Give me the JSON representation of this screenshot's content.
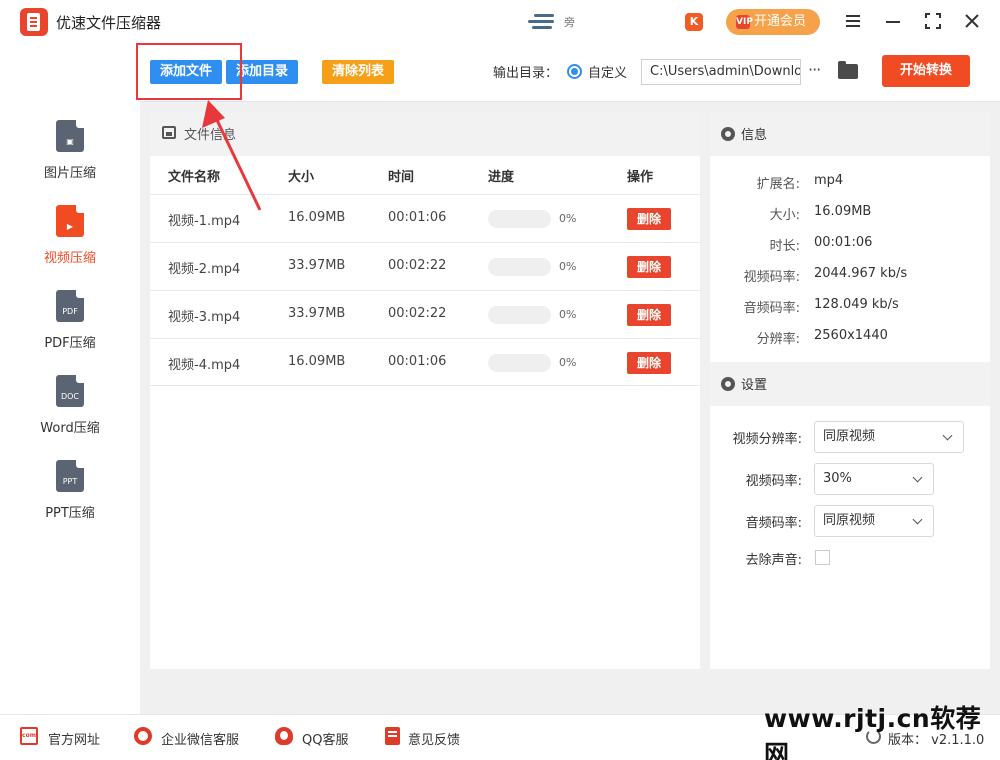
{
  "app": {
    "title": "优速文件压缩器",
    "center_badge": "旁"
  },
  "titlebar": {
    "k_badge": "K",
    "vip_label": "开通会员",
    "vip_icon": "VIP"
  },
  "toolbar": {
    "add_file": "添加文件",
    "add_dir": "添加目录",
    "clear_list": "清除列表",
    "output_label": "输出目录：",
    "radio_label": "自定义",
    "output_path": "C:\\Users\\admin\\Downloads",
    "more": "···",
    "start": "开始转换"
  },
  "sidebar": {
    "items": [
      {
        "label": "图片压缩",
        "glyph": "▣",
        "active": false
      },
      {
        "label": "视频压缩",
        "glyph": "▶",
        "active": true
      },
      {
        "label": "PDF压缩",
        "glyph": "PDF",
        "active": false
      },
      {
        "label": "Word压缩",
        "glyph": "DOC",
        "active": false
      },
      {
        "label": "PPT压缩",
        "glyph": "PPT",
        "active": false
      }
    ]
  },
  "files": {
    "header": "文件信息",
    "columns": [
      "文件名称",
      "大小",
      "时间",
      "进度",
      "操作"
    ],
    "rows": [
      {
        "name": "视频-1.mp4",
        "size": "16.09MB",
        "time": "00:01:06",
        "progress": "0%",
        "action": "删除"
      },
      {
        "name": "视频-2.mp4",
        "size": "33.97MB",
        "time": "00:02:22",
        "progress": "0%",
        "action": "删除"
      },
      {
        "name": "视频-3.mp4",
        "size": "33.97MB",
        "time": "00:02:22",
        "progress": "0%",
        "action": "删除"
      },
      {
        "name": "视频-4.mp4",
        "size": "16.09MB",
        "time": "00:01:06",
        "progress": "0%",
        "action": "删除"
      }
    ]
  },
  "info": {
    "header": "信息",
    "fields": [
      {
        "key": "扩展名:",
        "value": "mp4"
      },
      {
        "key": "大小:",
        "value": "16.09MB"
      },
      {
        "key": "时长:",
        "value": "00:01:06"
      },
      {
        "key": "视频码率:",
        "value": "2044.967 kb/s"
      },
      {
        "key": "音频码率:",
        "value": "128.049 kb/s"
      },
      {
        "key": "分辨率:",
        "value": "2560x1440"
      }
    ]
  },
  "settings": {
    "header": "设置",
    "resolution_label": "视频分辨率:",
    "resolution_value": "同原视频",
    "vbitrate_label": "视频码率:",
    "vbitrate_value": "30%",
    "abitrate_label": "音频码率:",
    "abitrate_value": "同原视频",
    "mute_label": "去除声音:"
  },
  "footer": {
    "site": "官方网址",
    "site_icon": "com",
    "wechat": "企业微信客服",
    "qq": "QQ客服",
    "feedback": "意见反馈",
    "version": "版本：  v2.1.1.0",
    "watermark": "www.rjtj.cn软荐网"
  },
  "colors": {
    "accent": "#f04b23",
    "primary": "#2f8ff0",
    "warning": "#f6a019"
  }
}
